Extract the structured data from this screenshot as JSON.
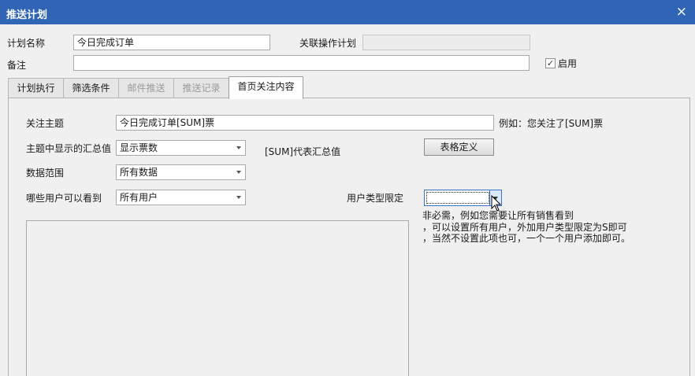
{
  "window": {
    "title": "推送计划",
    "close_glyph": "×"
  },
  "form": {
    "plan_name_label": "计划名称",
    "plan_name_value": "今日完成订单",
    "related_plan_label": "关联操作计划",
    "related_plan_value": "",
    "remark_label": "备注",
    "remark_value": "",
    "enable_label": "启用",
    "enable_checked_glyph": "✓"
  },
  "tabs": [
    {
      "label": "计划执行",
      "state": "normal"
    },
    {
      "label": "筛选条件",
      "state": "normal"
    },
    {
      "label": "邮件推送",
      "state": "disabled"
    },
    {
      "label": "推送记录",
      "state": "disabled"
    },
    {
      "label": "首页关注内容",
      "state": "active"
    }
  ],
  "panel": {
    "subject_label": "关注主题",
    "subject_value": "今日完成订单[SUM]票",
    "subject_example": "例如：您关注了[SUM]票",
    "summary_label": "主题中显示的汇总值",
    "summary_value": "显示票数",
    "sum_hint": "[SUM]代表汇总值",
    "table_def_button": "表格定义",
    "range_label": "数据范围",
    "range_value": "所有数据",
    "visible_label": "哪些用户可以看到",
    "visible_value": "所有用户",
    "user_type_label": "用户类型限定",
    "user_type_value": "",
    "notes": [
      "非必需，例如您需要让所有销售看到",
      "，可以设置所有用户，外加用户类型限定为S即可",
      "，当然不设置此项也可，一个一个用户添加即可。"
    ]
  },
  "icons": {
    "close": "close-icon",
    "dropdown": "chevron-down-icon",
    "cursor": "mouse-pointer-icon"
  },
  "colors": {
    "titlebar": "#2f65b4",
    "focus_border": "#3a73c8"
  }
}
